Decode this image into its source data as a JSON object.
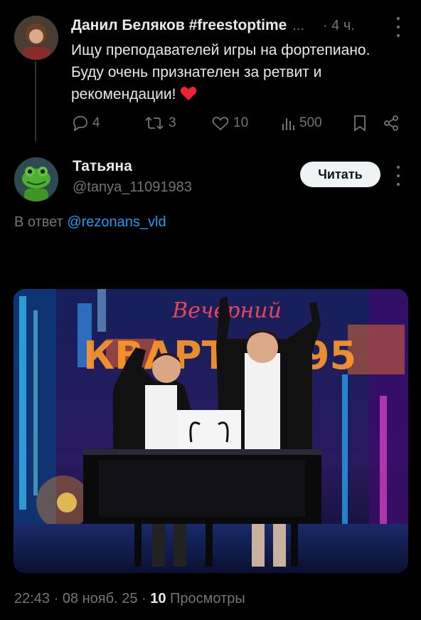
{
  "parent_tweet": {
    "author_name": "Данил Беляков #freestoptime",
    "name_ellipsis": "...",
    "time": "· 4 ч.",
    "text": "Ищу преподавателей игры на фортепиано. Буду очень признателен за ретвит и рекомендации!",
    "emoji": "heart",
    "actions": {
      "replies": "4",
      "retweets": "3",
      "likes": "10",
      "views": "500"
    }
  },
  "reply_tweet": {
    "author_name": "Татьяна",
    "handle": "@tanya_11091983",
    "follow_label": "Читать",
    "reply_prefix": "В ответ",
    "reply_mention": "@rezonans_vld",
    "media_caption_logo": "Вечерний КВАРТАЛ 95",
    "meta_time": "22:43 · 08 нояб. 25 ·",
    "meta_views_count": "10",
    "meta_views_label": "Просмотры"
  },
  "icons": [
    "reply-icon",
    "retweet-icon",
    "like-icon",
    "views-icon",
    "bookmark-icon",
    "share-icon",
    "more-icon"
  ],
  "colors": {
    "background": "#000000",
    "text": "#e7e9ea",
    "muted": "#71767b",
    "link": "#1d9bf0",
    "heart": "#f4212e"
  }
}
